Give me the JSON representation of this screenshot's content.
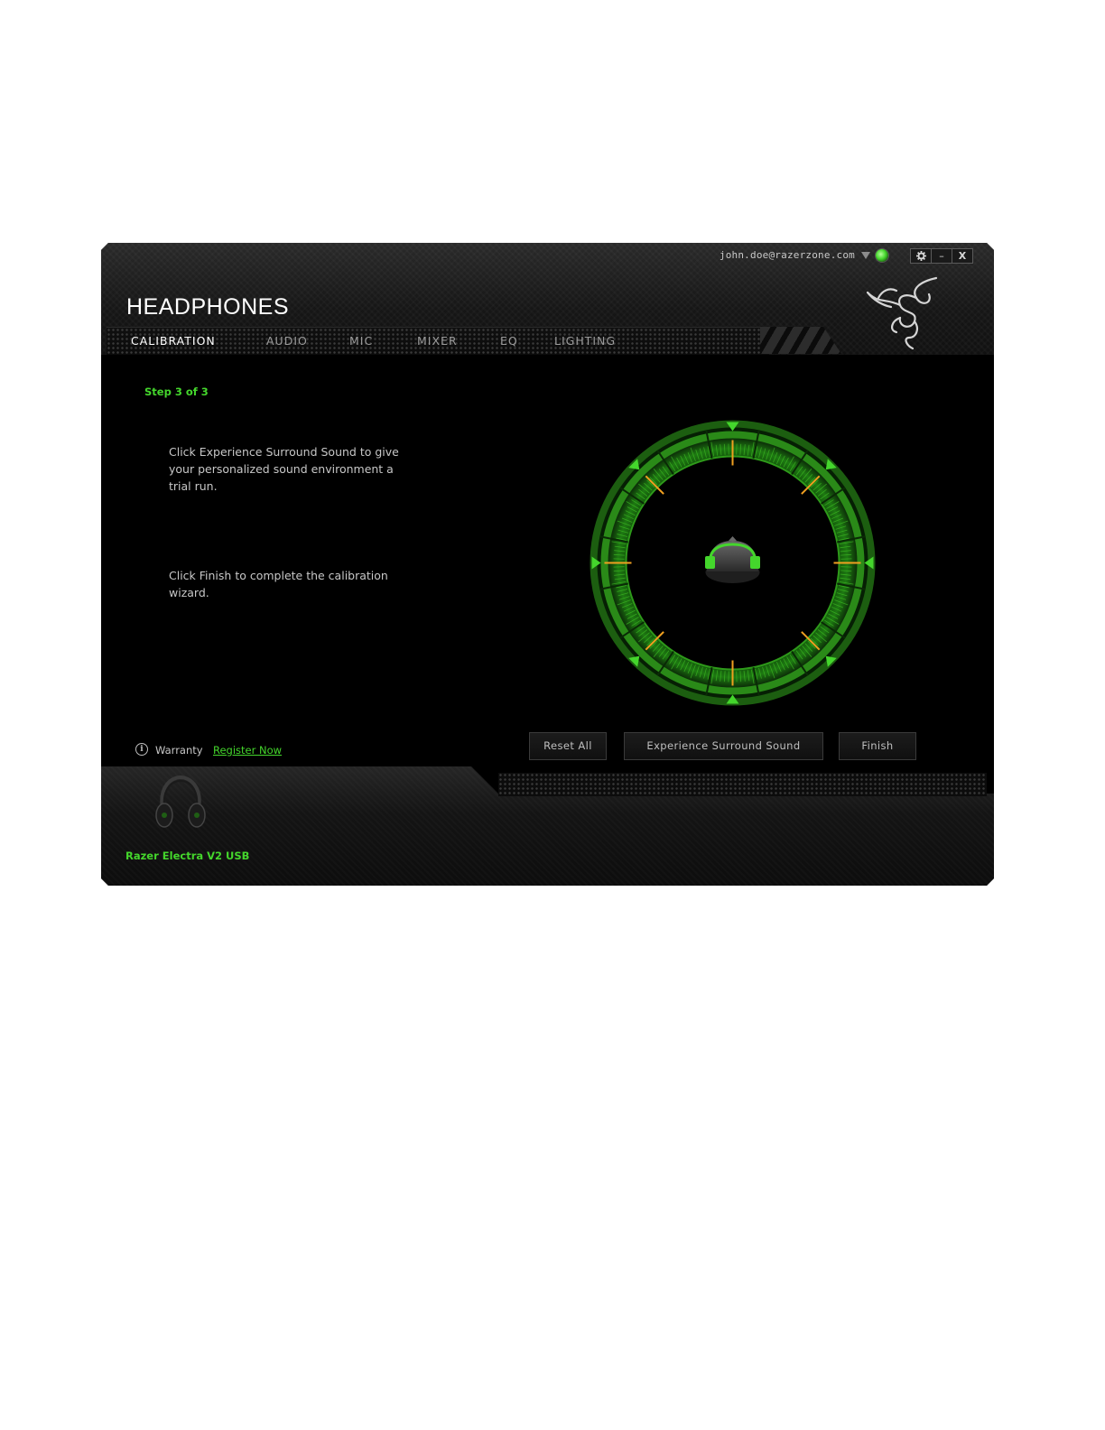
{
  "window": {
    "account_email": "john.doe@razerzone.com",
    "controls": {
      "settings_icon": "gear-icon",
      "minimize": "–",
      "close": "X"
    }
  },
  "header": {
    "title": "HEADPHONES",
    "tabs": [
      {
        "label": "CALIBRATION",
        "active": true
      },
      {
        "label": "AUDIO",
        "active": false
      },
      {
        "label": "MIC",
        "active": false
      },
      {
        "label": "MIXER",
        "active": false
      },
      {
        "label": "EQ",
        "active": false
      },
      {
        "label": "LIGHTING",
        "active": false
      }
    ]
  },
  "calibration": {
    "step": "Step 3 of 3",
    "instruction_1": "Click Experience Surround Sound to give your personalized sound environment a trial run.",
    "instruction_2": "Click Finish to complete the calibration wizard."
  },
  "footer_actions": {
    "warranty_label": "Warranty",
    "register_link": "Register Now",
    "reset_button": "Reset All",
    "experience_button": "Experience Surround Sound",
    "finish_button": "Finish"
  },
  "device": {
    "name": "Razer Electra V2 USB"
  },
  "colors": {
    "accent": "#44d62c",
    "marker": "#f0a020",
    "background": "#000000"
  }
}
